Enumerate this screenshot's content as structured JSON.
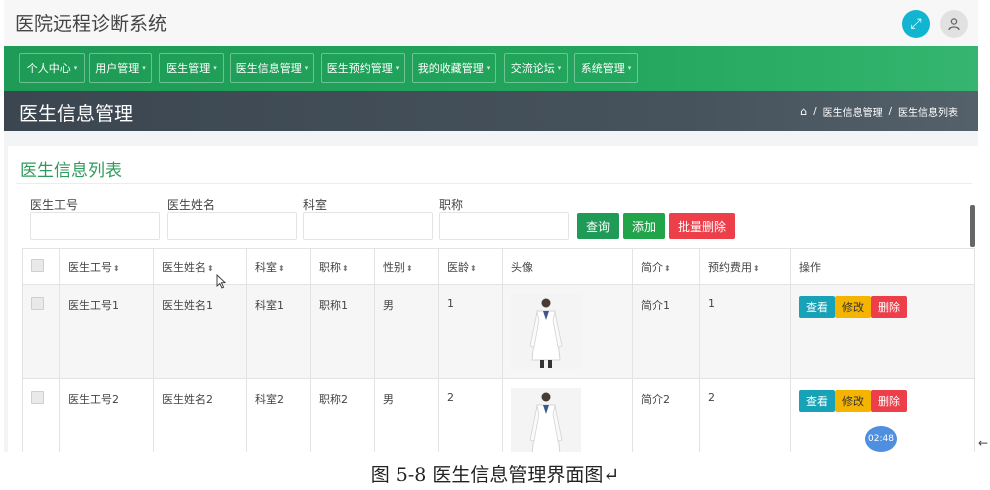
{
  "app": {
    "title": "医院远程诊断系统",
    "fullscreen_icon": "expand-icon",
    "user_icon": "user-icon"
  },
  "nav": {
    "items": [
      "个人中心",
      "用户管理",
      "医生管理",
      "医生信息管理",
      "医生预约管理",
      "我的收藏管理",
      "交流论坛",
      "系统管理"
    ]
  },
  "header": {
    "title": "医生信息管理",
    "breadcrumb": [
      "医生信息管理",
      "医生信息列表"
    ]
  },
  "list": {
    "title": "医生信息列表",
    "filters": [
      {
        "label": "医生工号",
        "value": ""
      },
      {
        "label": "医生姓名",
        "value": ""
      },
      {
        "label": "科室",
        "value": ""
      },
      {
        "label": "职称",
        "value": ""
      }
    ],
    "buttons": {
      "query": "查询",
      "add": "添加",
      "batch_delete": "批量删除"
    },
    "columns": [
      "医生工号",
      "医生姓名",
      "科室",
      "职称",
      "性别",
      "医龄",
      "头像",
      "简介",
      "预约费用",
      "操作"
    ],
    "sort_symbol": "⬍",
    "rows": [
      {
        "id": "医生工号1",
        "name": "医生姓名1",
        "dept": "科室1",
        "title": "职称1",
        "gender": "男",
        "years": "1",
        "intro": "简介1",
        "fee": "1"
      },
      {
        "id": "医生工号2",
        "name": "医生姓名2",
        "dept": "科室2",
        "title": "职称2",
        "gender": "男",
        "years": "2",
        "intro": "简介2",
        "fee": "2"
      }
    ],
    "actions": {
      "view": "查看",
      "edit": "修改",
      "delete": "删除"
    }
  },
  "overlay": {
    "time": "02:48",
    "arrow": "←"
  },
  "caption": "图 5-8 医生信息管理界面图↵",
  "colors": {
    "nav_green": "#22a55c",
    "header_dark": "#46525c",
    "title_green": "#2e9a5c",
    "danger": "#ec3f4a",
    "info": "#17a2b8",
    "warning": "#f5b400"
  }
}
